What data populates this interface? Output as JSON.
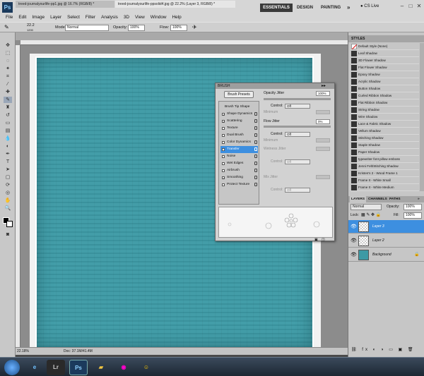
{
  "app": {
    "logo": "Ps",
    "workspaces": [
      "ESSENTIALS",
      "DESIGN",
      "PAINTING",
      "»"
    ],
    "cs_live": "CS Live"
  },
  "menu": [
    "File",
    "Edit",
    "Image",
    "Layer",
    "Select",
    "Filter",
    "Analysis",
    "3D",
    "View",
    "Window",
    "Help"
  ],
  "options": {
    "brush_size": "22.2",
    "brush_size2": "1200",
    "mode_label": "Mode:",
    "mode_value": "Normal",
    "opacity_label": "Opacity:",
    "opacity_value": "100%",
    "flow_label": "Flow:",
    "flow_value": "100%"
  },
  "tabs": [
    "treed-journalyourlife-pp1.jpg @ 16.7% (RGB/8) *",
    "treed-journalyourlife-ppsolid4.jpg @ 22.2% (Layer 3, RGB/8) *"
  ],
  "status": {
    "zoom": "22.18%",
    "doc": "Doc: 37.1M/41.4M"
  },
  "brush_panel": {
    "title": "BRUSH",
    "presets_button": "Brush Presets",
    "options": [
      "Brush Tip Shape",
      "Shape Dynamics",
      "Scattering",
      "Texture",
      "Dual Brush",
      "Color Dynamics",
      "Transfer",
      "Noise",
      "Wet Edges",
      "Airbrush",
      "Smoothing",
      "Protect Texture"
    ],
    "checked": [
      false,
      true,
      true,
      false,
      false,
      false,
      true,
      false,
      false,
      false,
      true,
      false
    ],
    "opacity_jitter_label": "Opacity Jitter",
    "opacity_jitter_value": "100%",
    "control_label": "Control:",
    "control_value": "Off",
    "minimum_label": "Minimum",
    "flow_jitter_label": "Flow Jitter",
    "flow_jitter_value": "0%",
    "control2_value": "Off",
    "minimum2_label": "Minimum",
    "wetness_label": "Wetness Jitter",
    "control3_value": "Off",
    "mix_label": "Mix Jitter",
    "control4_value": "Off"
  },
  "styles_panel": {
    "title": "STYLES",
    "items": [
      "Default Style (None)",
      "Leaf Shadow",
      "3D Flower Shadow",
      "Flat Flower Shadow",
      "Epoxy Shadow",
      "Acrylic Shadow",
      "Button Shadow",
      "Curled Ribbon Shadow",
      "Flat Ribbon Shadow",
      "String Shadow",
      "Wire Shadow",
      "Lace & Fabric Shadow",
      "Vellum Shadow",
      "Stitching Shadow",
      "Staple Shadow",
      "Paper Shadow",
      "typewriter font pillow emboss",
      "Jenni Felt/Stitching Shadow",
      "Kristen's 2 - Wood Frame 1",
      "Frame It - White Small",
      "Frame It - White Medium"
    ]
  },
  "layers_panel": {
    "tabs": [
      "LAYERS",
      "CHANNELS",
      "PATHS",
      "»"
    ],
    "blend_mode": "Normal",
    "opacity_label": "Opacity:",
    "opacity_value": "100%",
    "lock_label": "Lock:",
    "fill_label": "Fill:",
    "fill_value": "100%",
    "layers": [
      "Layer 3",
      "Layer 2",
      "Background"
    ]
  },
  "taskbar": {
    "apps": [
      "start-orb",
      "ie",
      "Lr",
      "Ps",
      "explorer",
      "chrome",
      "messenger"
    ]
  }
}
